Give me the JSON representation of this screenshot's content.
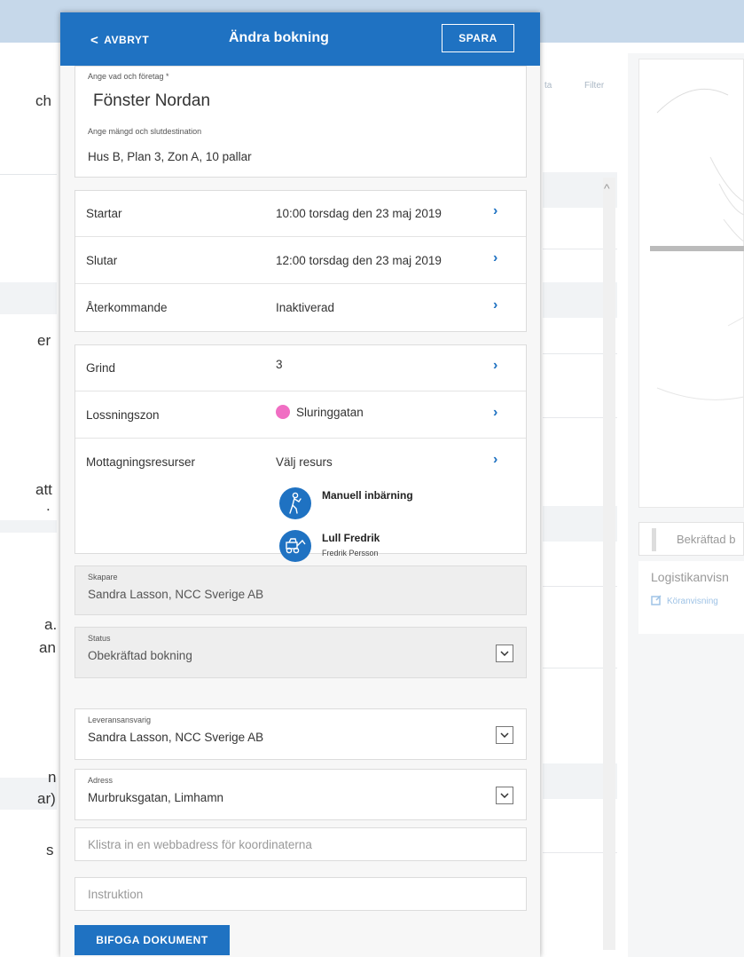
{
  "colors": {
    "primary": "#1f72c2",
    "zone_dot": "#f06ec3",
    "background_bar": "#c6d8ea"
  },
  "background": {
    "left_fragments": [
      "ch",
      "er",
      "att",
      ".",
      "a.",
      "an",
      "n",
      "ar)",
      "s"
    ],
    "middle_headers": [
      "ta",
      "Filter"
    ],
    "confirm_label": "Bekräftad b",
    "logistics_title": "Logistikanvisn",
    "logistics_link": "Köranvisning"
  },
  "header": {
    "cancel_label": "AVBRYT",
    "title": "Ändra bokning",
    "save_label": "SPARA"
  },
  "what": {
    "label": "Ange vad och företag *",
    "value": "Fönster Nordan",
    "amount_label": "Ange mängd och slutdestination",
    "amount_value": "Hus B, Plan 3, Zon A, 10 pallar"
  },
  "schedule": {
    "start_label": "Startar",
    "start_value": "10:00  torsdag den 23 maj 2019",
    "end_label": "Slutar",
    "end_value": "12:00  torsdag den 23 maj 2019",
    "recurring_label": "Återkommande",
    "recurring_value": "Inaktiverad"
  },
  "location": {
    "gate_label": "Grind",
    "gate_value": "3",
    "zone_label": "Lossningszon",
    "zone_value": "Sluringgatan",
    "resources_label": "Mottagningsresurser",
    "resources_value": "Välj resurs",
    "resources": [
      {
        "name": "Manuell inbärning",
        "sub": ""
      },
      {
        "name": "Lull Fredrik",
        "sub": "Fredrik Persson"
      }
    ]
  },
  "creator": {
    "label": "Skapare",
    "value": "Sandra Lasson, NCC Sverige AB"
  },
  "status": {
    "label": "Status",
    "value": "Obekräftad bokning"
  },
  "responsible": {
    "label": "Leveransansvarig",
    "value": "Sandra Lasson, NCC Sverige AB"
  },
  "address": {
    "label": "Adress",
    "value": "Murbruksgatan, Limhamn"
  },
  "coords_input": {
    "placeholder": "Klistra in en webbadress för koordinaterna"
  },
  "instruction_input": {
    "placeholder": "Instruktion"
  },
  "attach_label": "BIFOGA DOKUMENT"
}
